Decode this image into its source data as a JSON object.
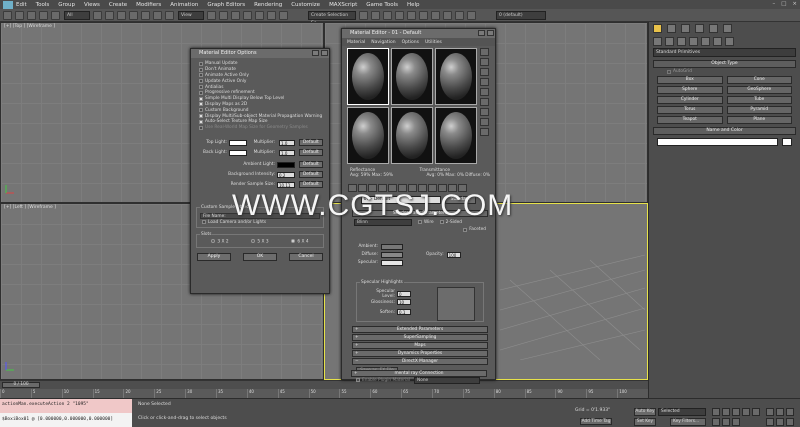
{
  "menu": [
    "Edit",
    "Tools",
    "Group",
    "Views",
    "Create",
    "Modifiers",
    "Animation",
    "Graph Editors",
    "Rendering",
    "Customize",
    "MAXScript",
    "Game Tools",
    "Help"
  ],
  "toolbar": {
    "filter_select": "All",
    "view_select": "View",
    "selection_set_placeholder": "Create Selection Se",
    "layer_label": "0 (default)"
  },
  "viewports": {
    "top": "[+] [Top ] [Wireframe ]",
    "left": "[+] [Left ] [Wireframe ]"
  },
  "watermark": "WWW.CGTSJ.COM",
  "command_panel": {
    "category": "Standard Primitives",
    "object_type_header": "Object Type",
    "autogrid_label": "AutoGrid",
    "objects": [
      "Box",
      "Cone",
      "Sphere",
      "GeoSphere",
      "Cylinder",
      "Tube",
      "Torus",
      "Pyramid",
      "Teapot",
      "Plane"
    ],
    "name_color_header": "Name and Color"
  },
  "options_dialog": {
    "title": "Material Editor Options",
    "options": [
      {
        "label": "Manual Update",
        "checked": false,
        "dim": false
      },
      {
        "label": "Don't Animate",
        "checked": false,
        "dim": false
      },
      {
        "label": "Animate Active Only",
        "checked": false,
        "dim": false
      },
      {
        "label": "Update Active Only",
        "checked": false,
        "dim": false
      },
      {
        "label": "Antialias",
        "checked": false,
        "dim": false
      },
      {
        "label": "Progressive refinement",
        "checked": false,
        "dim": false
      },
      {
        "label": "Simple Multi Display Below Top Level",
        "checked": true,
        "dim": false
      },
      {
        "label": "Display Maps as 2D",
        "checked": true,
        "dim": false
      },
      {
        "label": "Custom Background",
        "checked": false,
        "dim": false
      },
      {
        "label": "Display Multi/Sub-object Material Propagation Warning",
        "checked": true,
        "dim": false
      },
      {
        "label": "Auto-Select Texture Map Size",
        "checked": true,
        "dim": false
      },
      {
        "label": "Use Real-World Map Size for Geometry Samples",
        "checked": false,
        "dim": true
      }
    ],
    "top_light_label": "Top Light:",
    "back_light_label": "Back Light:",
    "multiplier_label": "Multiplier:",
    "top_mult": "1.0",
    "back_mult": "1.0",
    "default_label": "Default",
    "ambient_label": "Ambient Light:",
    "bg_intensity_label": "Background Intensity:",
    "bg_intensity": "0.2",
    "render_size_label": "Render Sample Size:",
    "render_size": "10.11",
    "custom_sample_header": "Custom Sample Object:",
    "file_name_label": "File Name:",
    "load_camera_label": "Load Camera and/or Lights",
    "slots_header": "Slots",
    "slot_options": [
      "3 X 2",
      "5 X 3",
      "6 X 4"
    ],
    "slot_selected": 2,
    "apply": "Apply",
    "ok": "OK",
    "cancel": "Cancel",
    "colors": {
      "top_light": "#ffffff",
      "back_light": "#ffffff",
      "ambient": "#000000"
    }
  },
  "material_editor": {
    "title": "Material Editor - 01 - Default",
    "menu": [
      "Material",
      "Navigation",
      "Options",
      "Utilities"
    ],
    "reflectance_label": "Reflectance",
    "reflectance_values": "Avg:  59% Max:  59%",
    "transmittance_label": "Transmittance",
    "transmittance_values": "Avg:  0% Max:  0%   Diffuse:  0%",
    "material_name": "01 - Default",
    "type_button": "Standard",
    "shader_basic_header": "Shader Basic Parameters",
    "shader_type": "Blinn",
    "wire_label": "Wire",
    "two_sided_label": "2-Sided",
    "faceted_label": "Faceted",
    "ambient_label": "Ambient:",
    "diffuse_label": "Diffuse:",
    "specular_label": "Specular:",
    "opacity_label": "Opacity:",
    "opacity_value": "100",
    "spec_highlights_header": "Specular Highlights",
    "spec_level_label": "Specular Level:",
    "spec_level": "0",
    "glossiness_label": "Glossiness:",
    "glossiness": "10",
    "soften_label": "Soften:",
    "soften": "0.1",
    "rollouts": [
      "Extended Parameters",
      "SuperSampling",
      "Maps",
      "Dynamics Properties",
      "DirectX Manager"
    ],
    "save_fx_button": "Save as .FX File",
    "enable_plugin_label": "Enable Plugin Material",
    "plugin_value": "None",
    "mental_ray_header": "mental ray Connection"
  },
  "timeline": {
    "slider_label": "0 / 100",
    "ticks": [
      "0",
      "5",
      "10",
      "15",
      "20",
      "25",
      "30",
      "35",
      "40",
      "45",
      "50",
      "55",
      "60",
      "65",
      "70",
      "75",
      "80",
      "85",
      "90",
      "95",
      "100"
    ]
  },
  "status": {
    "listener_line1": "actionMan.executeAction 2 \"1095\"",
    "listener_line2": "$BoxiBox01 @ [0.000000,0.000000,0.000000]",
    "none_selected": "None Selected",
    "prompt": "Click or click-and-drag to select objects",
    "grid": "Grid = 0'1.933\"",
    "add_time_tag": "Add Time Tag",
    "auto_key": "Auto Key",
    "selected": "Selected",
    "set_key": "Set Key",
    "key_filters": "Key Filters..."
  }
}
